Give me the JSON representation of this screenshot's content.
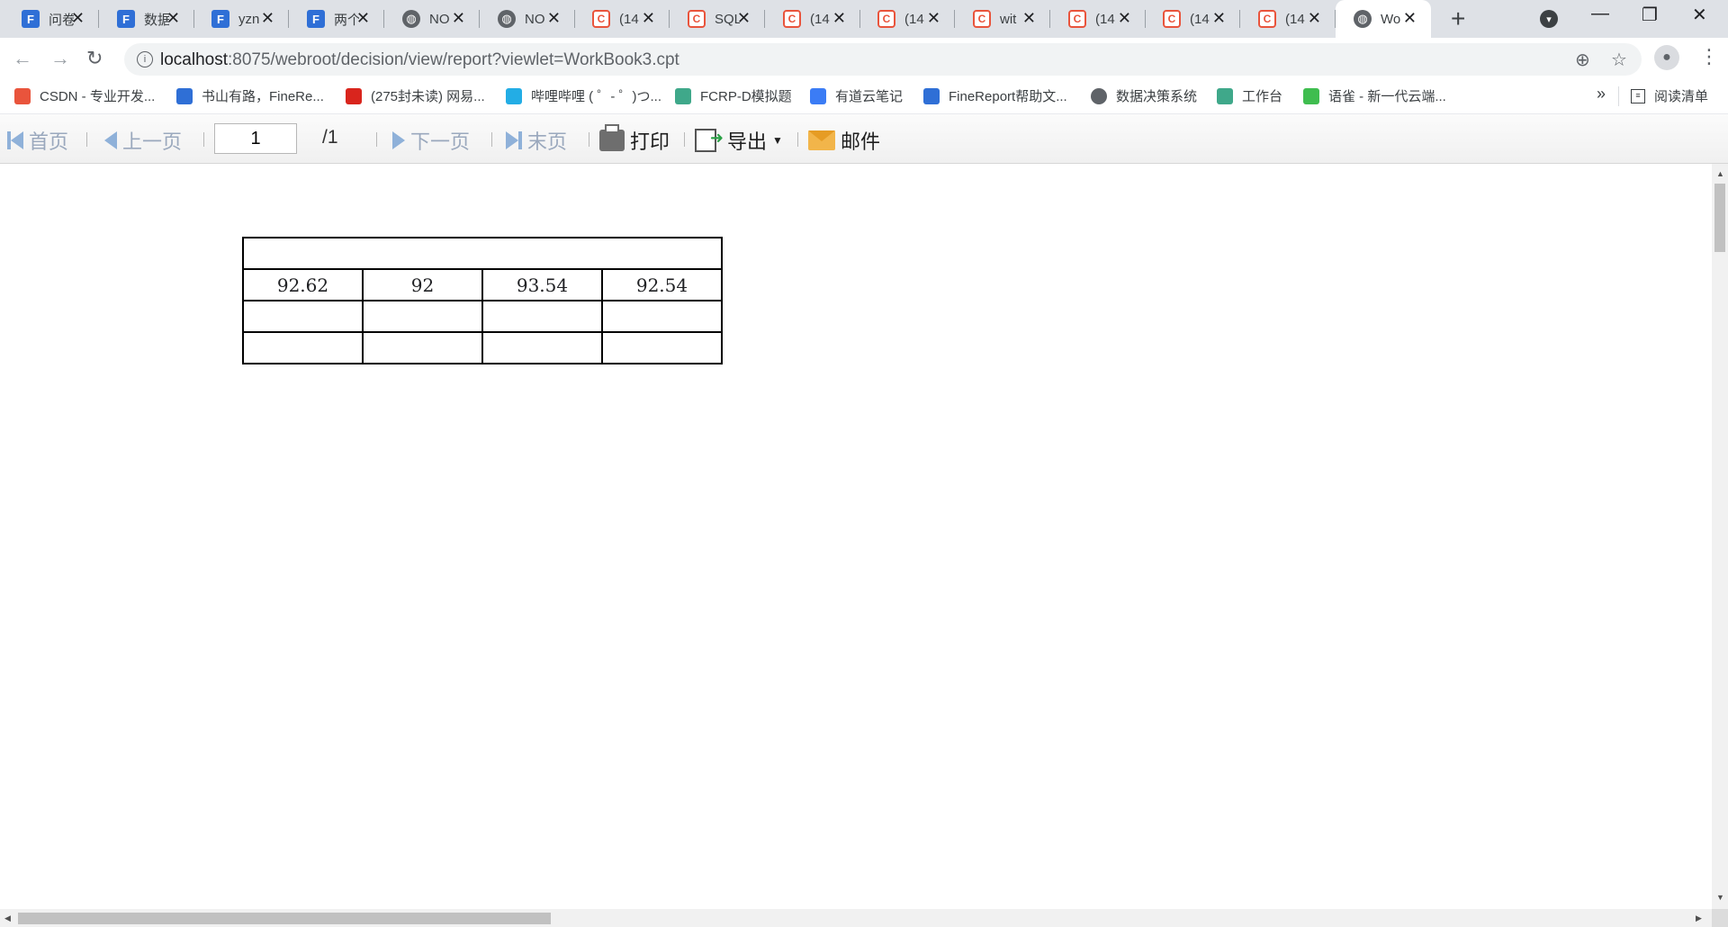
{
  "browser": {
    "tabs": [
      {
        "icon": "fine-icon",
        "title": "问卷"
      },
      {
        "icon": "fine-icon",
        "title": "数据"
      },
      {
        "icon": "fine-icon",
        "title": "yzn"
      },
      {
        "icon": "fine-icon",
        "title": "两个"
      },
      {
        "icon": "globe-icon",
        "title": "NO"
      },
      {
        "icon": "globe-icon",
        "title": "NO"
      },
      {
        "icon": "csdn-icon",
        "title": "(14"
      },
      {
        "icon": "csdn-icon",
        "title": "SQL"
      },
      {
        "icon": "csdn-icon",
        "title": "(14"
      },
      {
        "icon": "csdn-icon",
        "title": "(14"
      },
      {
        "icon": "csdn-icon",
        "title": "wit"
      },
      {
        "icon": "csdn-icon",
        "title": "(14"
      },
      {
        "icon": "csdn-icon",
        "title": "(14"
      },
      {
        "icon": "csdn-icon",
        "title": "(14"
      },
      {
        "icon": "globe-icon",
        "title": "Wo",
        "active": true
      }
    ],
    "url_host": "localhost",
    "url_rest": ":8075/webroot/decision/view/report?viewlet=WorkBook3.cpt",
    "bookmarks": [
      {
        "icon": "csdn-icon",
        "label": "CSDN - 专业开发...",
        "color": "#e9543c"
      },
      {
        "icon": "fine-icon",
        "label": "书山有路，FineRe...",
        "color": "#2f6fd6"
      },
      {
        "icon": "netease-icon",
        "label": "(275封未读) 网易...",
        "color": "#d9251d"
      },
      {
        "icon": "bilibili-icon",
        "label": "哔哩哔哩 ( ゜- ゜)つ...",
        "color": "#23ade5"
      },
      {
        "icon": "cloud-icon",
        "label": "FCRP-D模拟题",
        "color": "#3fa88a"
      },
      {
        "icon": "youdao-icon",
        "label": "有道云笔记",
        "color": "#3b7cf5"
      },
      {
        "icon": "fine-icon",
        "label": "FineReport帮助文...",
        "color": "#2f6fd6"
      },
      {
        "icon": "globe-icon",
        "label": "数据决策系统",
        "color": "#5f6368"
      },
      {
        "icon": "cloud-icon",
        "label": "工作台",
        "color": "#3fa88a"
      },
      {
        "icon": "yuque-icon",
        "label": "语雀 - 新一代云端...",
        "color": "#3fbd4f"
      }
    ],
    "bookmarks_more": "»",
    "reading_list": "阅读清单"
  },
  "report_toolbar": {
    "first_page": "首页",
    "prev_page": "上一页",
    "current_page": "1",
    "total_pages": "/1",
    "next_page": "下一页",
    "last_page": "末页",
    "print": "打印",
    "export": "导出",
    "mail": "邮件"
  },
  "report_table": {
    "rows": [
      [
        ""
      ],
      [
        "92.62",
        "92",
        "93.54",
        "92.54"
      ],
      [
        "",
        "",
        "",
        ""
      ],
      [
        "",
        "",
        "",
        ""
      ]
    ]
  }
}
